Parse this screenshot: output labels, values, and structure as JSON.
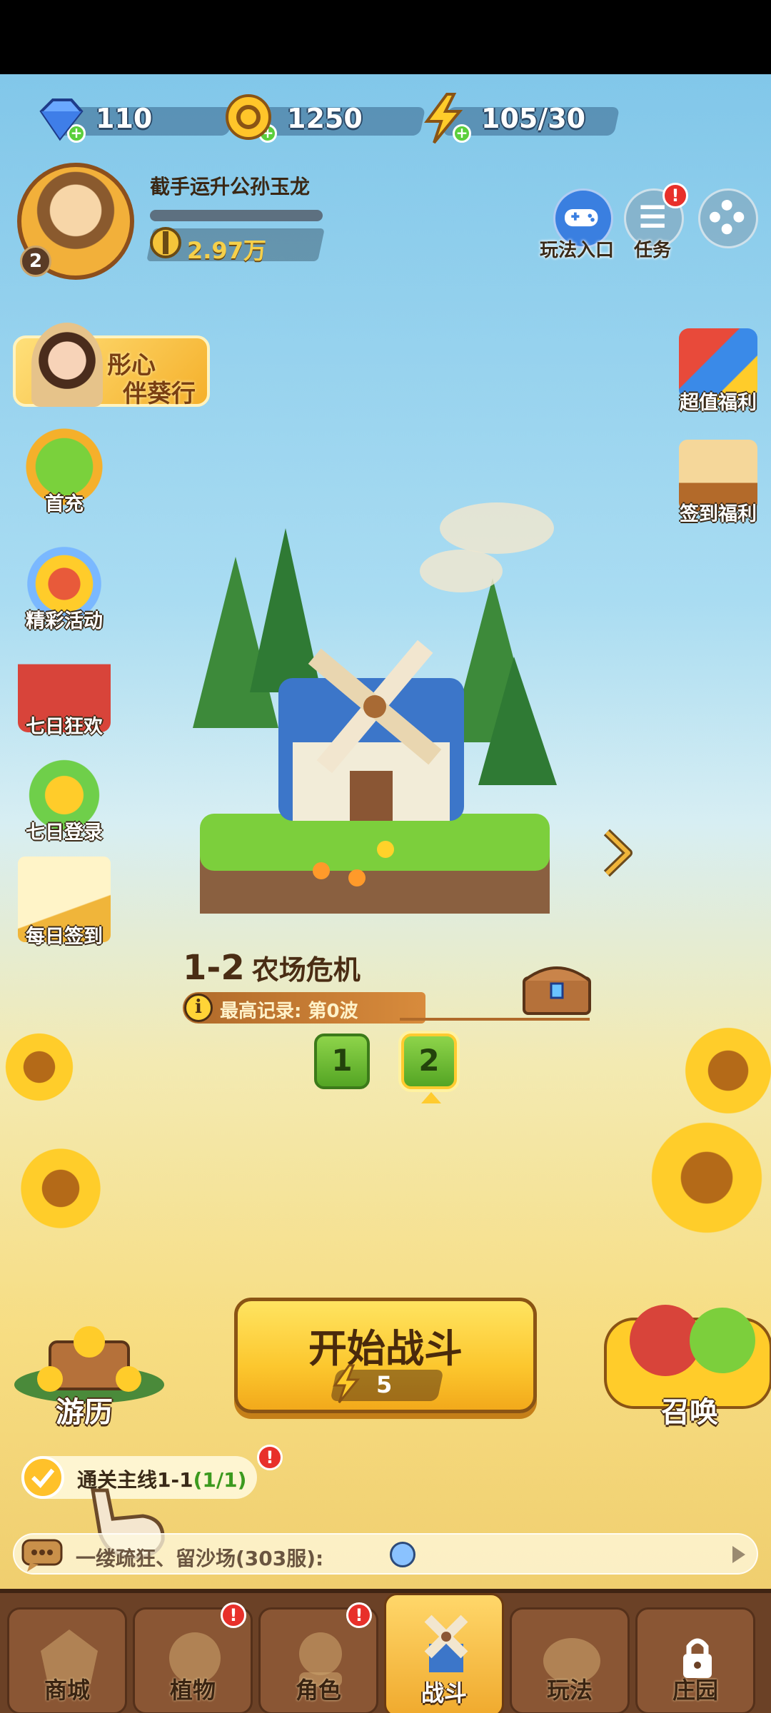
{
  "currencies": {
    "gems": "110",
    "coins": "1250",
    "energy": "105/30"
  },
  "player": {
    "name": "截手运升公孙玉龙",
    "level": "2",
    "power": "2.97万"
  },
  "top_buttons": {
    "play_entry": "玩法入口",
    "tasks": "任务",
    "task_badge": "!"
  },
  "banner": {
    "line1": "彤心",
    "line2": "伴葵行"
  },
  "left_events": [
    {
      "label": "首充"
    },
    {
      "label": "精彩活动"
    },
    {
      "label": "七日狂欢"
    },
    {
      "label": "七日登录"
    },
    {
      "label": "每日签到"
    }
  ],
  "right_events": [
    {
      "label": "超值福利"
    },
    {
      "label": "签到福利"
    }
  ],
  "stage": {
    "number": "1-2",
    "name": "农场危机",
    "record": "最高记录: 第0波",
    "waves": [
      "1",
      "2"
    ],
    "selected_wave": "2"
  },
  "start_button": {
    "label": "开始战斗",
    "cost": "5"
  },
  "travel": {
    "label": "游历"
  },
  "summon": {
    "label": "召唤"
  },
  "quest": {
    "text": "通关主线1-1",
    "progress": "(1/1)",
    "badge": "!"
  },
  "chat": {
    "text": "一缕疏狂、留沙场(303服):"
  },
  "nav": [
    {
      "label": "商城",
      "badge": ""
    },
    {
      "label": "植物",
      "badge": "!"
    },
    {
      "label": "角色",
      "badge": "!"
    },
    {
      "label": "战斗",
      "badge": ""
    },
    {
      "label": "玩法",
      "badge": ""
    },
    {
      "label": "庄园",
      "badge": ""
    }
  ],
  "colors": {
    "accent_yellow": "#fcc72e",
    "badge_red": "#e8302a",
    "nav_brown": "#6b4126",
    "wave_green": "#54a524"
  }
}
